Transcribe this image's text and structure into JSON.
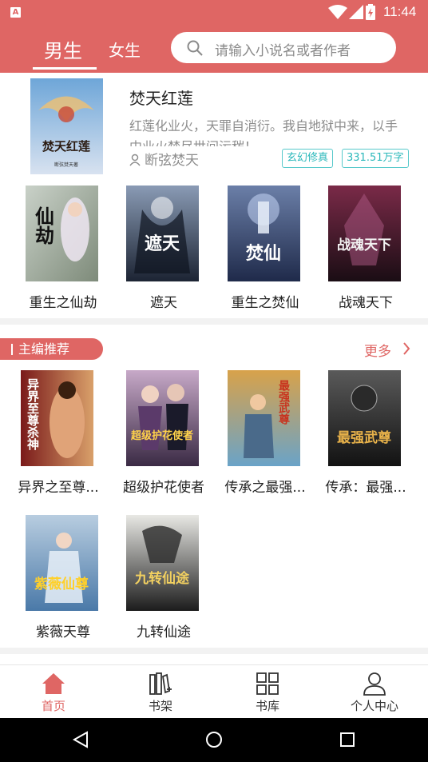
{
  "status_bar": {
    "app_badge": "A",
    "time": "11:44"
  },
  "header": {
    "tabs": [
      {
        "label": "男生",
        "active": true
      },
      {
        "label": "女生",
        "active": false
      }
    ],
    "search": {
      "placeholder": "请输入小说名或者作者"
    }
  },
  "featured": {
    "title": "焚天红莲",
    "description": "红莲化业火，天罪自消衍。我自地狱中来，以手中业火焚尽世间污秽！",
    "author": "断弦焚天",
    "tags": [
      "玄幻修真",
      "331.51万字"
    ],
    "cover": {
      "text": "焚天红莲",
      "credit": "断弦焚天著",
      "colors": [
        "#6ea6d8",
        "#d8e2f0"
      ]
    }
  },
  "top_books": [
    {
      "name": "重生之仙劫",
      "cover_text": "仙劫",
      "colors": [
        "#c9d1c8",
        "#7e8b7a"
      ]
    },
    {
      "name": "遮天",
      "cover_text": "遮天",
      "colors": [
        "#1c2433",
        "#8a9bb5"
      ]
    },
    {
      "name": "重生之焚仙",
      "cover_text": "焚仙",
      "colors": [
        "#1f2a4a",
        "#6b7fa8"
      ]
    },
    {
      "name": "战魂天下",
      "cover_text": "战魂天下",
      "colors": [
        "#1a0d14",
        "#7a2a48"
      ]
    }
  ],
  "editor_section": {
    "title": "主编推荐",
    "more_label": "更多",
    "books": [
      {
        "name": "异界之至尊...",
        "cover_text": "异界至尊杀神",
        "colors": [
          "#7a1a1a",
          "#d9a06a"
        ]
      },
      {
        "name": "超级护花使者",
        "cover_text": "超级护花使者",
        "colors": [
          "#3a2a44",
          "#c7a9c8"
        ]
      },
      {
        "name": "传承之最强...",
        "cover_text": "最强武尊",
        "colors": [
          "#d8a24a",
          "#6aa3c8"
        ]
      },
      {
        "name": "传承：最强...",
        "cover_text": "最强武尊",
        "colors": [
          "#121212",
          "#5a5a5a"
        ]
      },
      {
        "name": "紫薇天尊",
        "cover_text": "紫薇仙尊",
        "colors": [
          "#b8cde0",
          "#4a79a8"
        ]
      },
      {
        "name": "九转仙途",
        "cover_text": "九转仙途",
        "colors": [
          "#e8e8e4",
          "#1c1c1c"
        ]
      }
    ]
  },
  "bottom_nav": [
    {
      "label": "首页",
      "icon": "home-icon",
      "active": true
    },
    {
      "label": "书架",
      "icon": "bookshelf-icon",
      "active": false
    },
    {
      "label": "书库",
      "icon": "library-icon",
      "active": false
    },
    {
      "label": "个人中心",
      "icon": "profile-icon",
      "active": false
    }
  ],
  "colors": {
    "accent": "#df6664",
    "tag": "#2bb8bb",
    "muted": "#8d8d8d"
  }
}
